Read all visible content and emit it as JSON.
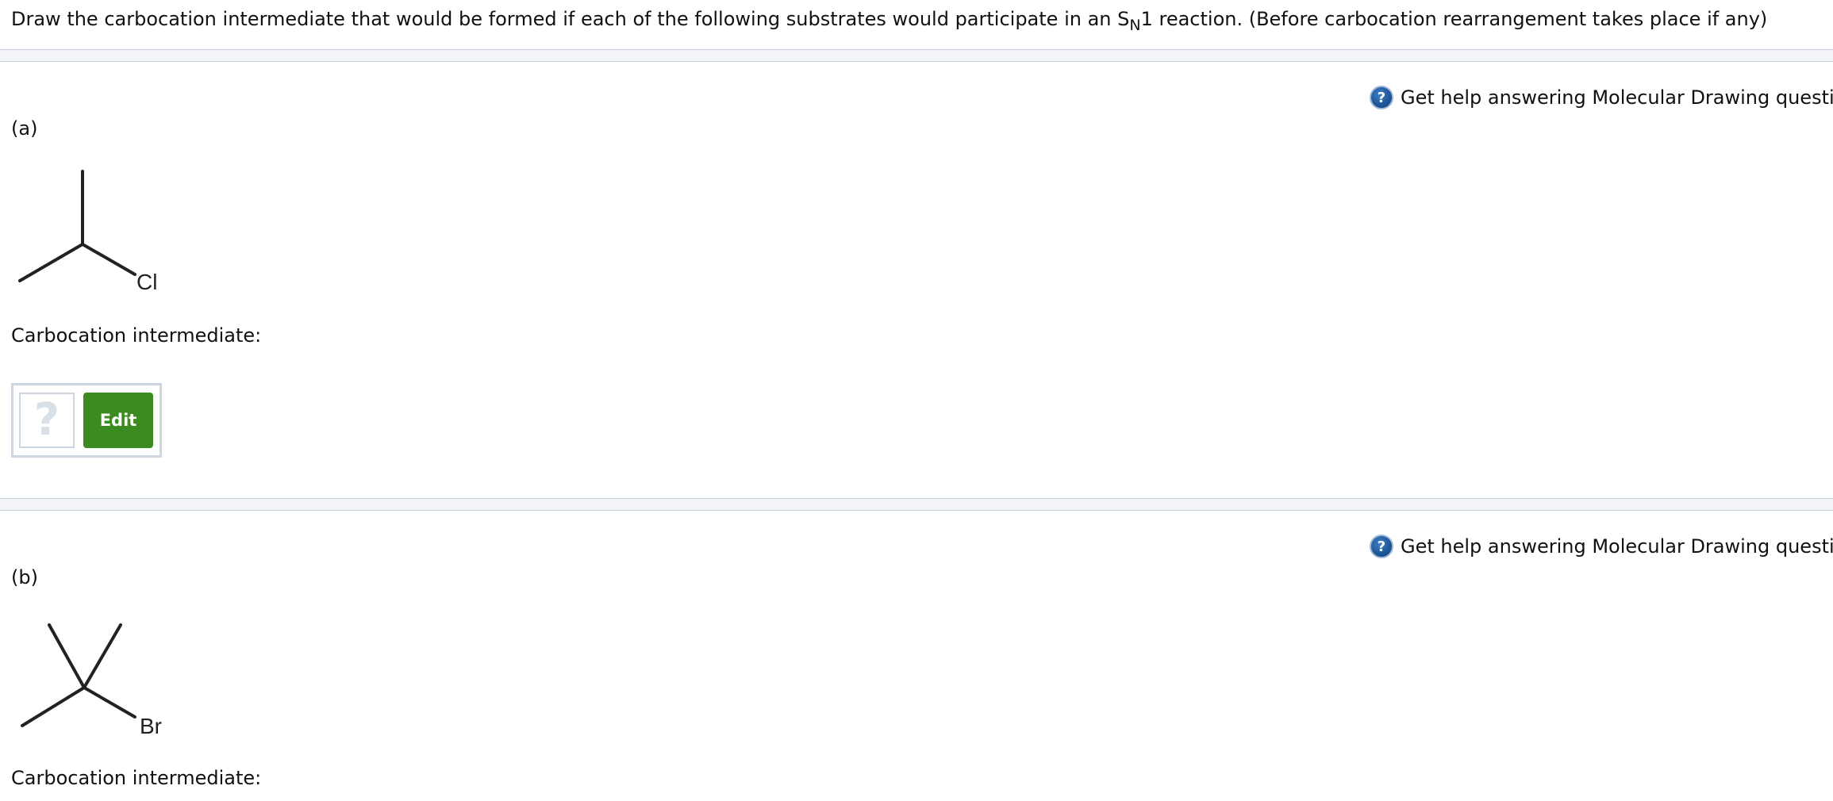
{
  "question": {
    "prefix": "Draw the carbocation intermediate that would be formed if each of the following substrates would participate in an S",
    "subscript": "N",
    "suffix": "1 reaction. (Before carbocation rearrangement takes place if any)"
  },
  "parts": [
    {
      "help_label": "Get help answering Molecular Drawing questions.",
      "help_icon": "?",
      "label": "(a)",
      "substrate_atom": "Cl",
      "answer_label": "Carbocation intermediate:",
      "preview_mark": "?",
      "edit_label": "Edit"
    },
    {
      "help_label": "Get help answering Molecular Drawing questions.",
      "help_icon": "?",
      "label": "(b)",
      "substrate_atom": "Br",
      "answer_label": "Carbocation intermediate:"
    }
  ],
  "colors": {
    "edit_button": "#3b8b21",
    "help_icon": "#1c5597",
    "divider": "#c4cfdb"
  }
}
